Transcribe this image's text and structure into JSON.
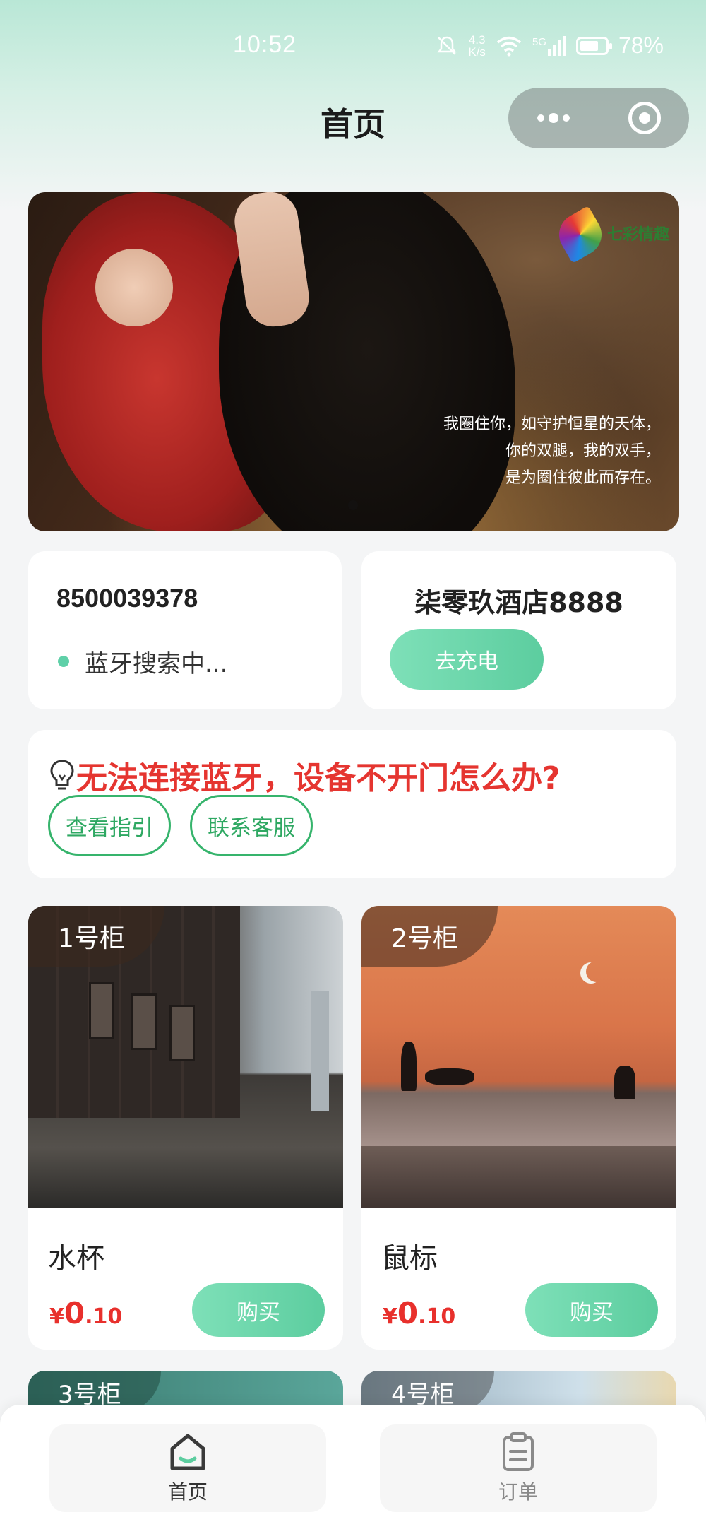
{
  "status_bar": {
    "time": "10:52",
    "speed_top": "4.3",
    "speed_bottom": "K/s",
    "network": "5G",
    "battery": "78%"
  },
  "nav": {
    "title": "首页"
  },
  "banner": {
    "logo_text": "七彩情趣",
    "caption_lines": [
      "我圈住你，如守护恒星的天体，",
      "你的双腿，我的双手，",
      "是为圈住彼此而存在。"
    ]
  },
  "device": {
    "id": "8500039378",
    "bluetooth_status": "蓝牙搜索中..."
  },
  "hotel": {
    "name": "柒零玖酒店8888",
    "charge_label": "去充电"
  },
  "help": {
    "question": "无法连接蓝牙，设备不开门怎么办?",
    "guide_label": "查看指引",
    "service_label": "联系客服"
  },
  "products": [
    {
      "cabinet": "1号柜",
      "name": "水杯",
      "currency": "¥",
      "price_int": "0",
      "price_dec": ".10",
      "buy_label": "购买"
    },
    {
      "cabinet": "2号柜",
      "name": "鼠标",
      "currency": "¥",
      "price_int": "0",
      "price_dec": ".10",
      "buy_label": "购买"
    },
    {
      "cabinet": "3号柜"
    },
    {
      "cabinet": "4号柜"
    }
  ],
  "tabbar": {
    "home": "首页",
    "orders": "订单"
  },
  "colors": {
    "accent": "#5ccd9f",
    "price": "#e8302c",
    "help_text": "#e53530",
    "outline": "#36b46c"
  },
  "icons": [
    "mute-icon",
    "wifi-icon",
    "signal-icon",
    "battery-icon",
    "more-icon",
    "close-icon",
    "bulb-icon",
    "home-icon",
    "orders-icon"
  ]
}
